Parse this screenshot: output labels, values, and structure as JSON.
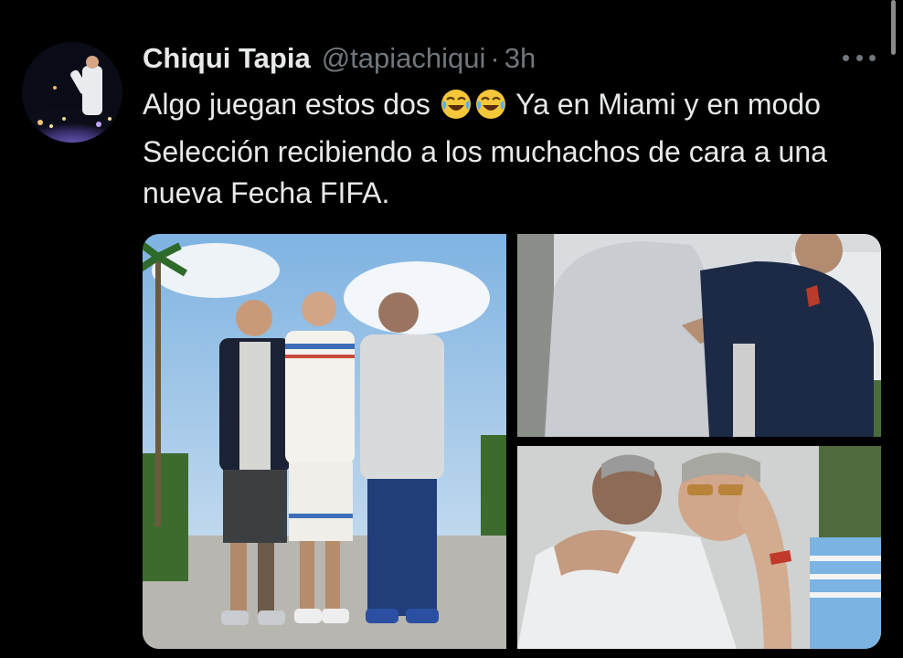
{
  "tweet": {
    "author_name": "Chiqui Tapia",
    "handle": "@tapiachiqui",
    "separator": "·",
    "time": "3h",
    "text_part1": "Algo juegan estos dos ",
    "text_emoji": "😂😂",
    "text_part2": " Ya en Miami y en modo Selección recibiendo a los muchachos de cara a una nueva Fecha FIFA."
  },
  "media": {
    "image_count": 3
  },
  "colors": {
    "background": "#000000",
    "text_primary": "#e7e9ea",
    "text_secondary": "#71767b"
  },
  "icons": {
    "more": "more-horizontal-icon",
    "emoji": "tears-of-joy-emoji"
  }
}
